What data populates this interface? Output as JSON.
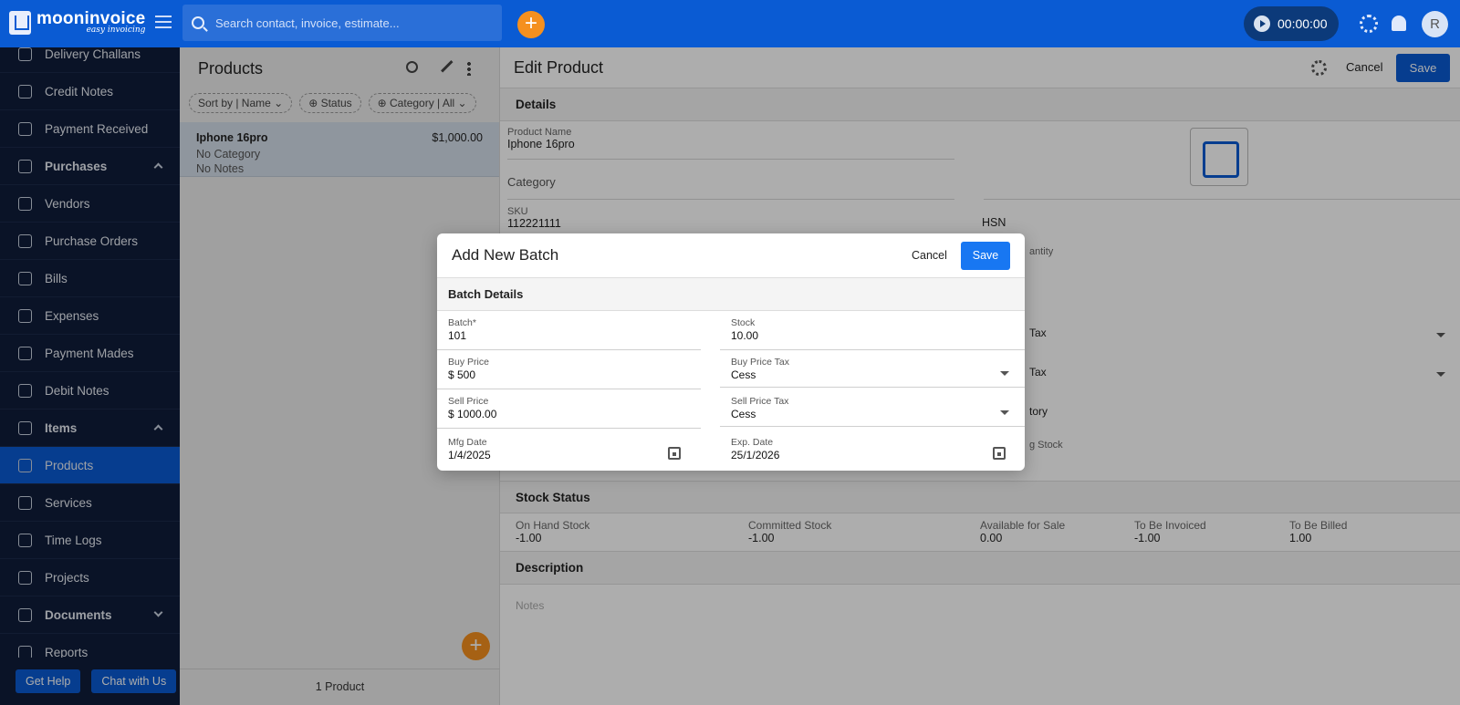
{
  "topbar": {
    "logo_name": "mooninvoice",
    "logo_tagline": "easy invoicing",
    "search_placeholder": "Search contact, invoice, estimate...",
    "add_label": "+",
    "timer": "00:00:00",
    "avatar_initial": "R",
    "colors": {
      "bar": "#0a5bd3",
      "accent": "#f5901e"
    }
  },
  "sidebar": {
    "items": [
      {
        "label": "Delivery Challans",
        "icon": "truck-icon"
      },
      {
        "label": "Credit Notes",
        "icon": "note-icon"
      },
      {
        "label": "Payment Received",
        "icon": "coin-icon"
      },
      {
        "label": "Purchases",
        "icon": "bag-icon",
        "section": true
      },
      {
        "label": "Vendors",
        "icon": "contacts-icon"
      },
      {
        "label": "Purchase Orders",
        "icon": "cart-icon"
      },
      {
        "label": "Bills",
        "icon": "bill-icon"
      },
      {
        "label": "Expenses",
        "icon": "wallet-icon"
      },
      {
        "label": "Payment Mades",
        "icon": "coin-icon"
      },
      {
        "label": "Debit Notes",
        "icon": "note-icon"
      },
      {
        "label": "Items",
        "icon": "list-icon",
        "section": true
      },
      {
        "label": "Products",
        "icon": "box-icon",
        "active": true
      },
      {
        "label": "Services",
        "icon": "clipboard-icon"
      },
      {
        "label": "Time Logs",
        "icon": "clock-icon"
      },
      {
        "label": "Projects",
        "icon": "folder-icon"
      },
      {
        "label": "Documents",
        "icon": "document-icon",
        "section": true
      },
      {
        "label": "Reports",
        "icon": "report-icon"
      }
    ],
    "get_help": "Get Help",
    "chat": "Chat with Us"
  },
  "products": {
    "title": "Products",
    "filters": [
      "Sort by | Name",
      "Status",
      "Category | All"
    ],
    "rows": [
      {
        "name": "Iphone 16pro",
        "price": "$1,000.00",
        "category": "No Category",
        "notes": "No Notes"
      }
    ],
    "fab": "+",
    "count": "1 Product"
  },
  "edit": {
    "title": "Edit Product",
    "cancel": "Cancel",
    "save": "Save",
    "details_title": "Details",
    "product_name_label": "Product Name",
    "product_name": "Iphone 16pro",
    "category_label": "Category",
    "sku_label": "SKU",
    "sku": "112221111",
    "hsn_label": "HSN",
    "quantity_label": "antity",
    "sell_tax_label": "Tax",
    "buy_tax_label": "Tax",
    "inventory_label": "tory",
    "opening_stock_label": "g Stock",
    "stock_status_title": "Stock Status",
    "stock": [
      {
        "label": "On Hand Stock",
        "value": "-1.00"
      },
      {
        "label": "Committed Stock",
        "value": "-1.00"
      },
      {
        "label": "Available for Sale",
        "value": "0.00"
      },
      {
        "label": "To Be Invoiced",
        "value": "-1.00"
      },
      {
        "label": "To Be Billed",
        "value": "1.00"
      }
    ],
    "description_title": "Description",
    "notes_placeholder": "Notes"
  },
  "modal": {
    "title": "Add New Batch",
    "cancel": "Cancel",
    "save": "Save",
    "section": "Batch Details",
    "batch_label": "Batch*",
    "batch": "101",
    "stock_label": "Stock",
    "stock": "10.00",
    "buy_price_label": "Buy Price",
    "buy_price": "$ 500",
    "buy_tax_label": "Buy Price Tax",
    "buy_tax": "Cess",
    "sell_price_label": "Sell Price",
    "sell_price": "$ 1000.00",
    "sell_tax_label": "Sell Price Tax",
    "sell_tax": "Cess",
    "mfg_label": "Mfg Date",
    "mfg": "1/4/2025",
    "exp_label": "Exp. Date",
    "exp": "25/1/2026"
  }
}
